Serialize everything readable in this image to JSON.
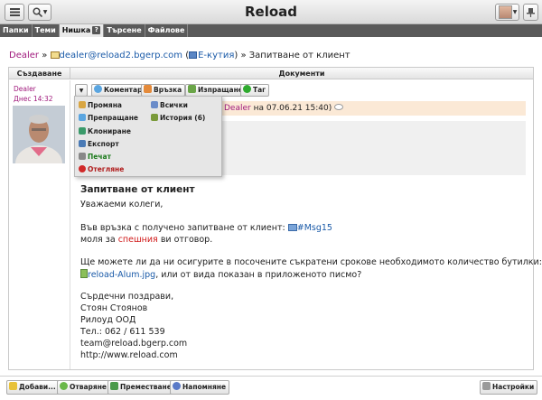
{
  "header": {
    "title": "Reload"
  },
  "tabs": [
    {
      "label": "Папки"
    },
    {
      "label": "Теми"
    },
    {
      "label": "Нишка",
      "badge": "?"
    },
    {
      "label": "Търсене"
    },
    {
      "label": "Файлове"
    }
  ],
  "breadcrumb": {
    "root": "Dealer",
    "sep1": "»",
    "email": "dealer@reload2.bgerp.com",
    "paren_open": "(",
    "inbox": "Е-кутия",
    "paren_close": ")",
    "sep2": "»",
    "current": "Запитване от клиент"
  },
  "table": {
    "col_created": "Създаване",
    "col_documents": "Документи"
  },
  "sender": {
    "name": "Dealer",
    "date": "Днес 14:32"
  },
  "toolbar": {
    "comment": "Коментар",
    "link": "Връзка",
    "send": "Изпращане",
    "tag": "Таг"
  },
  "infobar": {
    "author": "Dealer",
    "rest": "на 07.06.21 15:40)"
  },
  "menu": {
    "edit": "Промяна",
    "all": "Всички",
    "forward": "Препращане",
    "history": "История (6)",
    "clone": "Клониране",
    "export": "Експорт",
    "print": "Печат",
    "reject": "Отегляне"
  },
  "mail": {
    "subject": "Запитване от клиент",
    "greeting": "Уважаеми колеги,",
    "line1": "Във връзка с получено запитване от клиент:",
    "msg_ref": "#Msg15",
    "line2_a": "моля за",
    "line2_urgent": "спешния",
    "line2_b": "ви отговор.",
    "line3": "Ще можете ли да ни осигурите в посочените съкратени срокове необходимото количество бутилки:",
    "attachment": "reload-Alum.jpg",
    "line4": ", или от вида показан в приложеното писмо?",
    "regards": "Сърдечни поздрави,",
    "sig_name": "Стоян Стоянов",
    "sig_company": "Рилоуд ООД",
    "sig_phone": "Тел.: 062 / 611 539",
    "sig_email": "team@reload.bgerp.com",
    "sig_web": "http://www.reload.com"
  },
  "bottom": {
    "add": "Добави...",
    "open": "Отваряне",
    "move": "Преместване",
    "remind": "Напомняне",
    "settings": "Настройки"
  }
}
